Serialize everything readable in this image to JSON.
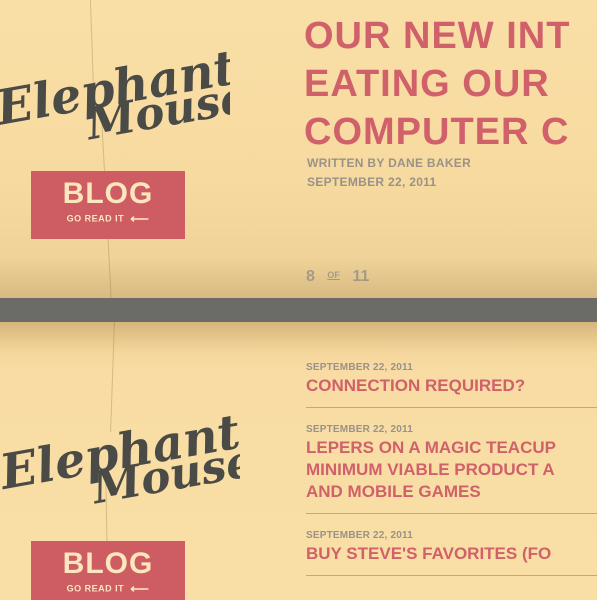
{
  "brand": {
    "logo_text_1": "Elephant",
    "logo_text_2": "Mouse"
  },
  "blog_button": {
    "label": "BLOG",
    "sub_label": "GO READ IT",
    "arrow": "⟵"
  },
  "article": {
    "title_lines": [
      "OUR NEW INT",
      "EATING OUR",
      "COMPUTER C"
    ],
    "byline": "WRITTEN BY DANE BAKER",
    "date": "SEPTEMBER 22, 2011"
  },
  "pager": {
    "current": "8",
    "of": "OF",
    "total": "11"
  },
  "posts": [
    {
      "date": "SEPTEMBER 22, 2011",
      "title_lines": [
        "CONNECTION REQUIRED?"
      ]
    },
    {
      "date": "SEPTEMBER 22, 2011",
      "title_lines": [
        "LEPERS ON A MAGIC TEACUP",
        "MINIMUM VIABLE PRODUCT A",
        "AND MOBILE GAMES"
      ]
    },
    {
      "date": "SEPTEMBER 22, 2011",
      "title_lines": [
        "BUY STEVE'S FAVORITES (FO"
      ]
    }
  ],
  "colors": {
    "accent": "#cd5c63",
    "paper": "#f9dfa6",
    "ink": "#4a4a46",
    "divider": "#6b6b68"
  }
}
